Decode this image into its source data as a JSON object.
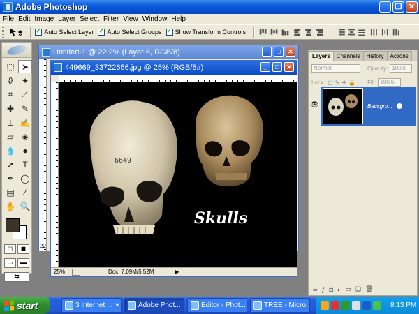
{
  "app": {
    "title": "Adobe Photoshop"
  },
  "window_buttons": {
    "minimize": "_",
    "restore": "❐",
    "close": "✕"
  },
  "menu": [
    {
      "u": "F",
      "rest": "ile"
    },
    {
      "u": "E",
      "rest": "dit"
    },
    {
      "u": "I",
      "rest": "mage"
    },
    {
      "u": "L",
      "rest": "ayer"
    },
    {
      "u": "S",
      "rest": "elect"
    },
    {
      "u": "",
      "rest": "Filter"
    },
    {
      "u": "V",
      "rest": "iew"
    },
    {
      "u": "W",
      "rest": "indow"
    },
    {
      "u": "H",
      "rest": "elp"
    }
  ],
  "options": {
    "auto_select_layer": "Auto Select Layer",
    "auto_select_groups": "Auto Select Groups",
    "show_transform": "Show Transform Controls"
  },
  "docs": {
    "back": {
      "title": "Untitled-1 @ 22.2% (Layer 6, RGB/8)",
      "zoom": "22"
    },
    "front": {
      "title": "449669_33722656.jpg @ 25% (RGB/8#)",
      "zoom": "25%",
      "doc_info": "Doc: 7.09M/5.52M",
      "canvas_text": "Skulls",
      "skull_label": "6649"
    }
  },
  "layers": {
    "tabs": [
      "Layers",
      "Channels",
      "History",
      "Actions"
    ],
    "blend_mode": "Normal",
    "opacity_label": "Opacity:",
    "opacity_value": "100%",
    "lock_label": "Lock:",
    "fill_label": "Fill:",
    "fill_value": "100%",
    "layer_name": "Backgro..."
  },
  "taskbar": {
    "start": "start",
    "items": [
      {
        "label": "3 Internet ..."
      },
      {
        "label": "Adobe Phot..."
      },
      {
        "label": "Editor - Phot..."
      },
      {
        "label": "TREE - Micro..."
      }
    ],
    "clock": "8:13 PM"
  },
  "colors": {
    "foreground": "#3a3326",
    "background": "#ffffff",
    "xp_blue": "#0548c4",
    "highlight": "#316ac5"
  }
}
